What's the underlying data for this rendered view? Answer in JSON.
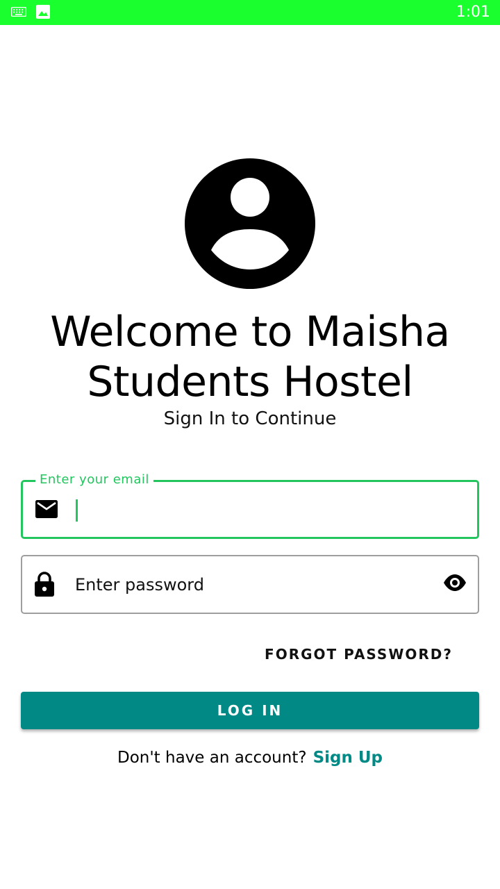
{
  "status_bar": {
    "time": "1:01",
    "background_color": "#1aff2e",
    "icons": [
      "keyboard-icon",
      "image-icon"
    ]
  },
  "header": {
    "avatar_icon": "account-circle-icon",
    "title": "Welcome to Maisha Students Hostel",
    "subtitle": "Sign In to Continue"
  },
  "form": {
    "email": {
      "label": "Enter your email",
      "value": "",
      "icon": "mail-icon",
      "accent_color": "#22c55e"
    },
    "password": {
      "placeholder": "Enter password",
      "value": "",
      "icon": "lock-icon",
      "toggle_icon": "eye-icon"
    },
    "forgot_password_label": "FORGOT PASSWORD?",
    "login_label": "LOG IN",
    "login_color": "#008985"
  },
  "footer": {
    "prompt": "Don't have an account?",
    "signup_label": "Sign Up"
  }
}
